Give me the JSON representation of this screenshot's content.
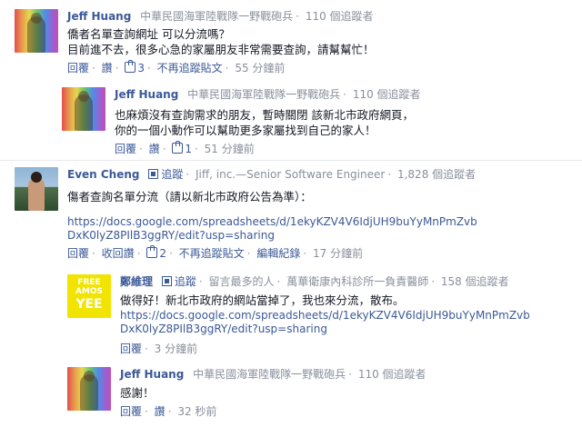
{
  "comments": [
    {
      "name": "Jeff Huang",
      "org": "中華民國海軍陸戰隊一野戰砲兵",
      "followers": "110 個追蹤者",
      "lines": [
        "僑者名單查詢網址 可以分流嗎？",
        "目前進不去，很多心急的家屬朋友非常需要查詢，請幫幫忙！"
      ],
      "reply": "回覆",
      "like": "讚",
      "like_count": "3",
      "unfollow": "不再追蹤貼文",
      "time": "55 分鐘前"
    },
    {
      "name": "Jeff Huang",
      "org": "中華民國海軍陸戰隊一野戰砲兵",
      "followers": "110 個追蹤者",
      "lines": [
        "也麻煩沒有查詢需求的朋友，暫時關閉 該新北市政府網頁，",
        "你的一個小動作可以幫助更多家屬找到自己的家人！"
      ],
      "reply": "回覆",
      "like": "讚",
      "like_count": "1",
      "time": "51 分鐘前"
    },
    {
      "name": "Even Cheng",
      "follow": "追蹤",
      "org": "Jiff, inc.—Senior Software Engineer",
      "followers": "1,828 個追蹤者",
      "text": "傷者查詢名單分流（請以新北市政府公告為準）：",
      "url1": "https://docs.google.com/spreadsheets/d/1ekyKZV4V6IdjUH9buYyMnPmZvb",
      "url2": "DxK0lyZ8PIlB3ggRY/edit?usp=sharing",
      "reply": "回覆",
      "unlike": "收回讚",
      "like_count": "2",
      "unfollow": "不再追蹤貼文",
      "history": "編輯紀錄",
      "time": "17 分鐘前"
    },
    {
      "name": "鄭維理",
      "follow": "追蹤",
      "badge": "留言最多的人",
      "org": "萬華衛康內科診所一負責醫師",
      "followers": "158 個追蹤者",
      "text": "做得好！新北市政府的網站當掉了，我也來分流，散布。",
      "url1": "https://docs.google.com/spreadsheets/d/1ekyKZV4V6IdjUH9buYyMnPmZvb",
      "url2": "DxK0lyZ8PIlB3ggRY/edit?usp=sharing",
      "reply": "回覆",
      "time": "3 分鐘前",
      "avatar_lines": [
        "FREE",
        "AMOS",
        "YEE"
      ]
    },
    {
      "name": "Jeff Huang",
      "org": "中華民國海軍陸戰隊一野戰砲兵",
      "followers": "110 個追蹤者",
      "text": "感謝！",
      "reply": "回覆",
      "like": "讚",
      "time": "32 秒前"
    }
  ],
  "colors": {
    "link": "#3b5998",
    "meta": "#898f9c",
    "yee_bg": "#f1e400"
  }
}
